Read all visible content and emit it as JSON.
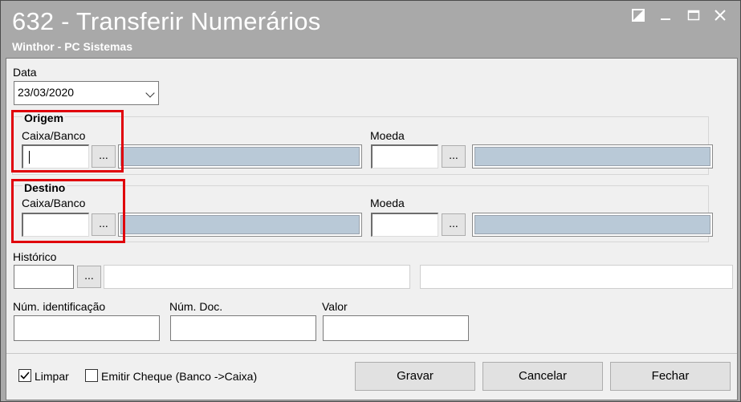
{
  "window": {
    "title": "632 - Transferir Numerários",
    "subtitle": "Winthor - PC Sistemas"
  },
  "form": {
    "data_label": "Data",
    "data_value": "23/03/2020",
    "origem": {
      "heading": "Origem",
      "caixa_label": "Caixa/Banco",
      "moeda_label": "Moeda",
      "lookup_label": "..."
    },
    "destino": {
      "heading": "Destino",
      "caixa_label": "Caixa/Banco",
      "moeda_label": "Moeda",
      "lookup_label": "..."
    },
    "historico_label": "Histórico",
    "historico_lookup_label": "...",
    "num_identificacao_label": "Núm. identificação",
    "num_doc_label": "Núm. Doc.",
    "valor_label": "Valor"
  },
  "footer": {
    "limpar_label": "Limpar",
    "limpar_checked": true,
    "emitir_cheque_label": "Emitir Cheque (Banco ->Caixa)",
    "emitir_cheque_checked": false,
    "gravar_label": "Gravar",
    "cancelar_label": "Cancelar",
    "fechar_label": "Fechar"
  },
  "colors": {
    "titlebar": "#a9a9a9",
    "highlight": "#e0000b",
    "readonly_field": "#b9c9d7"
  }
}
